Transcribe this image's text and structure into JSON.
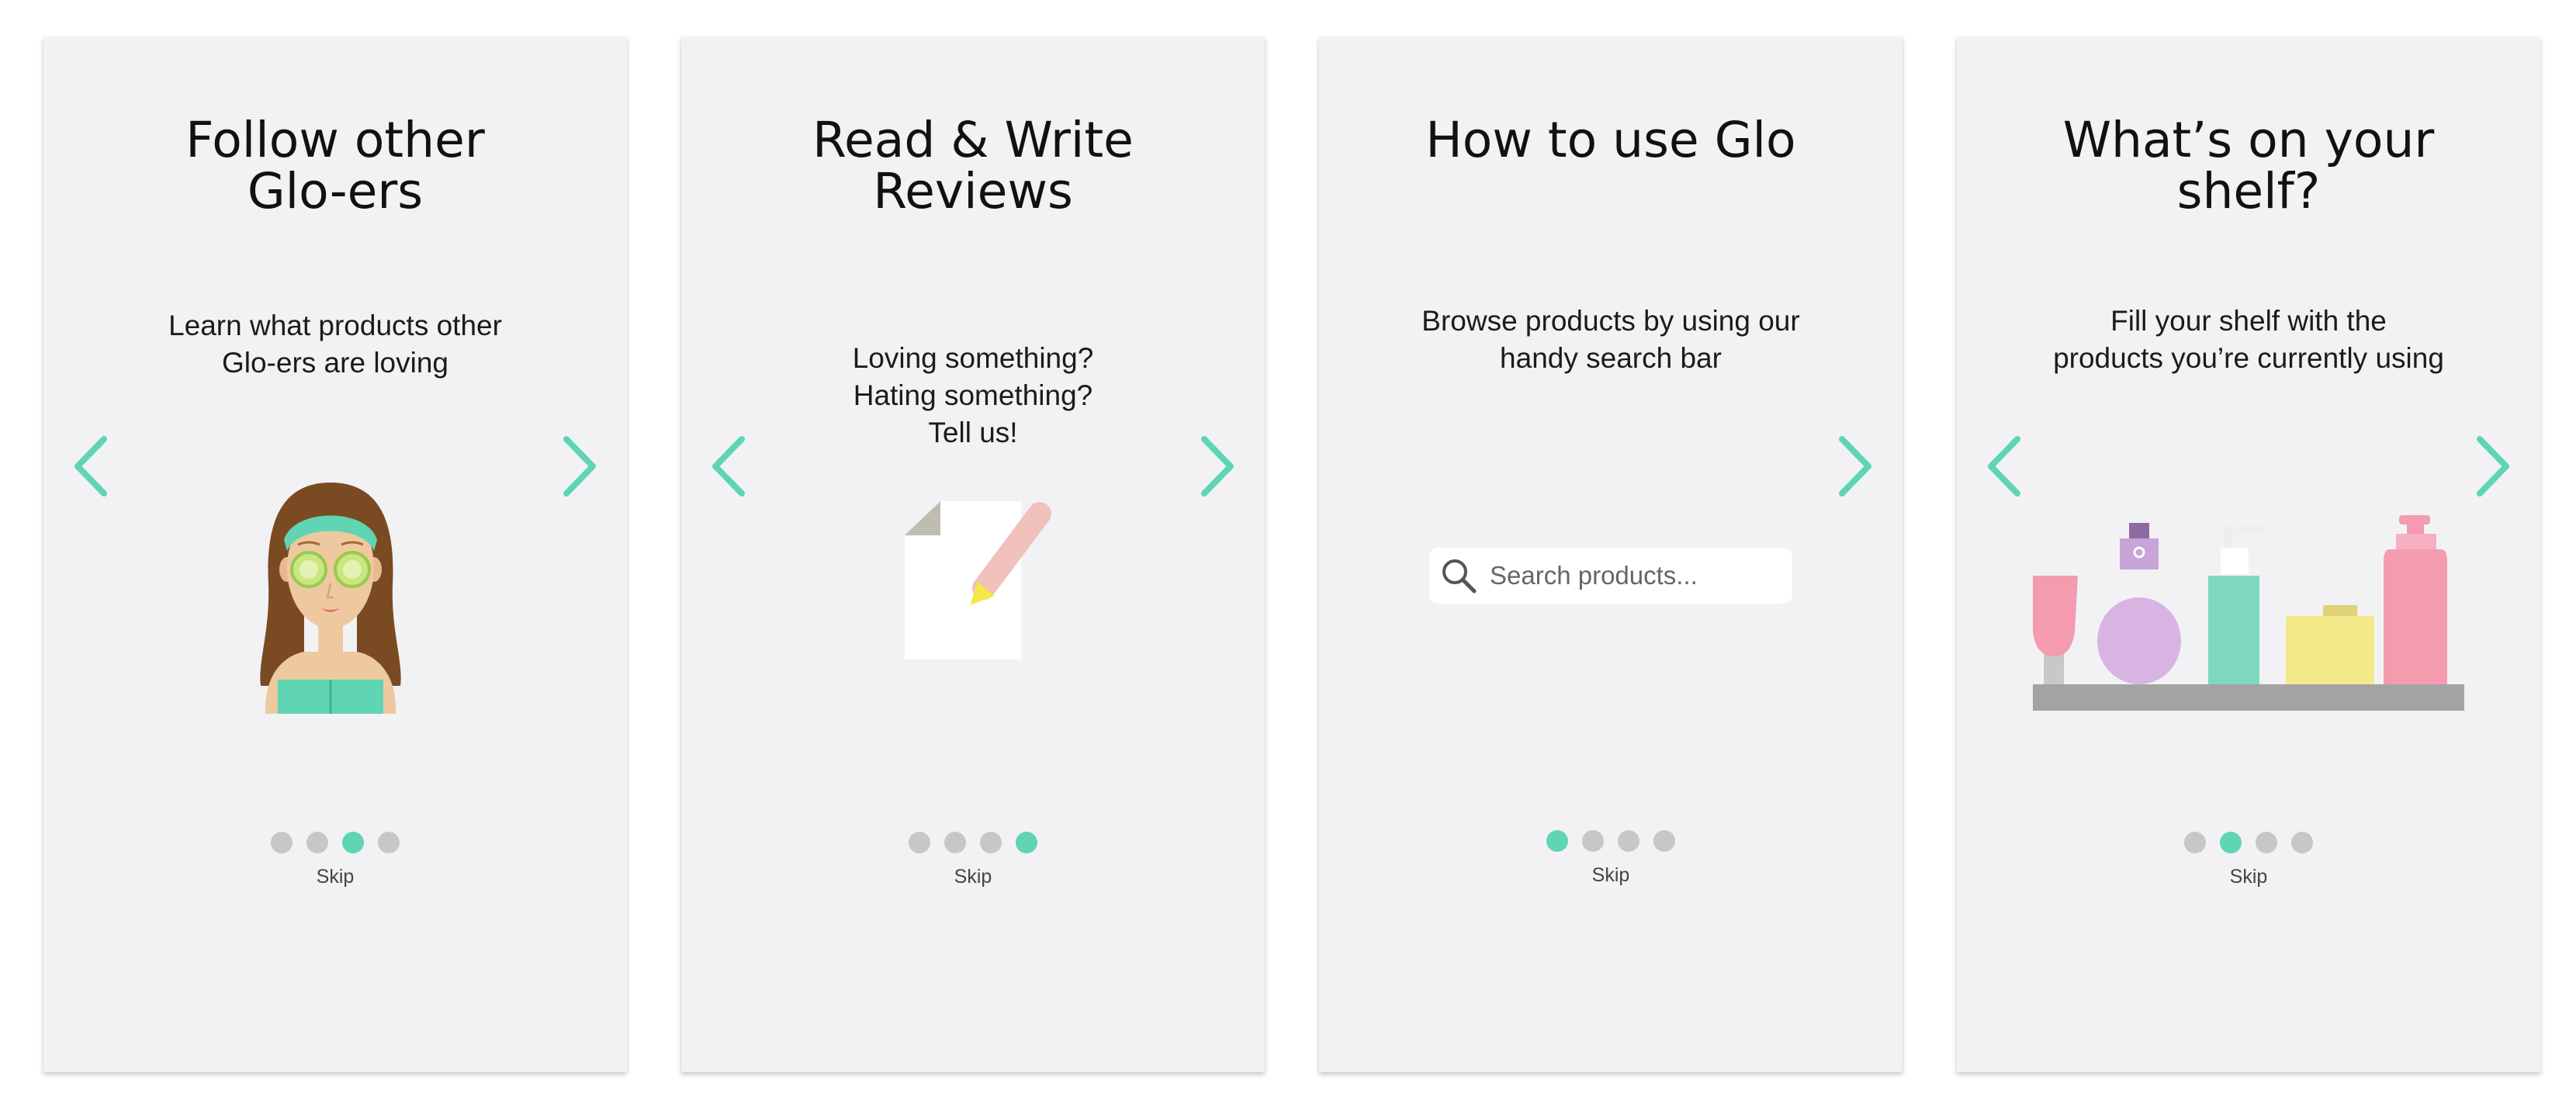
{
  "colors": {
    "accent": "#5fd5b3",
    "card_bg": "#f2f2f4",
    "dot_inactive": "#c7c7c9"
  },
  "cards": [
    {
      "title_lines": [
        "Follow other",
        "Glo-ers"
      ],
      "desc_lines": [
        "Learn what products other",
        "Glo-ers are loving"
      ],
      "illustration": "woman-face-mask-illustration",
      "page_indicator": {
        "total": 4,
        "active_index": 2
      },
      "skip_label": "Skip"
    },
    {
      "title_lines": [
        "Read & Write",
        "Reviews"
      ],
      "desc_lines": [
        "Loving something?",
        "Hating something?",
        "Tell us!"
      ],
      "illustration": "paper-and-pencil-illustration",
      "page_indicator": {
        "total": 4,
        "active_index": 3
      },
      "skip_label": "Skip"
    },
    {
      "title_lines": [
        "How to use Glo"
      ],
      "desc_lines": [
        "Browse products by using our",
        "handy search bar"
      ],
      "search": {
        "placeholder": "Search products..."
      },
      "page_indicator": {
        "total": 4,
        "active_index": 0
      },
      "skip_label": "Skip"
    },
    {
      "title_lines": [
        "What’s on your",
        "shelf?"
      ],
      "desc_lines": [
        "Fill your shelf with the",
        "products you’re currently using"
      ],
      "illustration": "product-shelf-illustration",
      "page_indicator": {
        "total": 4,
        "active_index": 1
      },
      "skip_label": "Skip"
    }
  ]
}
